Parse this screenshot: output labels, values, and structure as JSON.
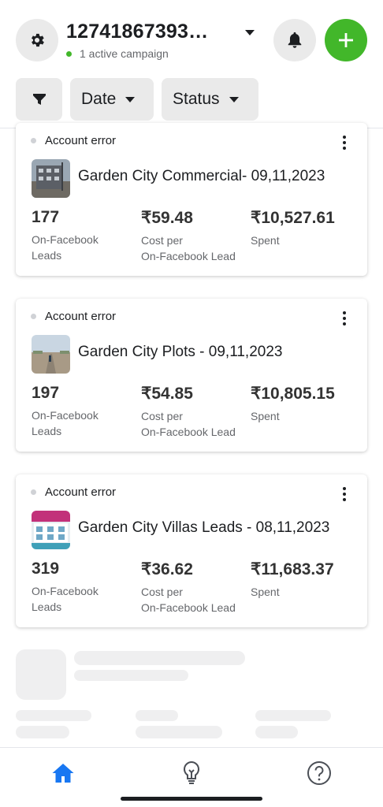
{
  "header": {
    "account_id": "12741867393…",
    "active_campaigns": "1 active campaign"
  },
  "filters": {
    "date_label": "Date",
    "status_label": "Status"
  },
  "campaigns": [
    {
      "status": "Account error",
      "name": "Garden City Commercial- 09,11,2023",
      "leads": "177",
      "leads_label": "On-Facebook\nLeads",
      "cost": "₹59.48",
      "cost_label": "Cost per\nOn-Facebook Lead",
      "spent": "₹10,527.61",
      "spent_label": "Spent"
    },
    {
      "status": "Account error",
      "name": "Garden City Plots - 09,11,2023",
      "leads": "197",
      "leads_label": "On-Facebook\nLeads",
      "cost": "₹54.85",
      "cost_label": "Cost per\nOn-Facebook Lead",
      "spent": "₹10,805.15",
      "spent_label": "Spent"
    },
    {
      "status": "Account error",
      "name": "Garden City Villas Leads - 08,11,2023",
      "leads": "319",
      "leads_label": "On-Facebook\nLeads",
      "cost": "₹36.62",
      "cost_label": "Cost per\nOn-Facebook Lead",
      "spent": "₹11,683.37",
      "spent_label": "Spent"
    }
  ],
  "nav": {
    "items": [
      "home-icon",
      "lightbulb-icon",
      "help-icon"
    ],
    "active": "home-icon"
  },
  "colors": {
    "accent_green": "#42b72a",
    "nav_active_blue": "#1877f2",
    "chip_bg": "#eaeaea"
  }
}
